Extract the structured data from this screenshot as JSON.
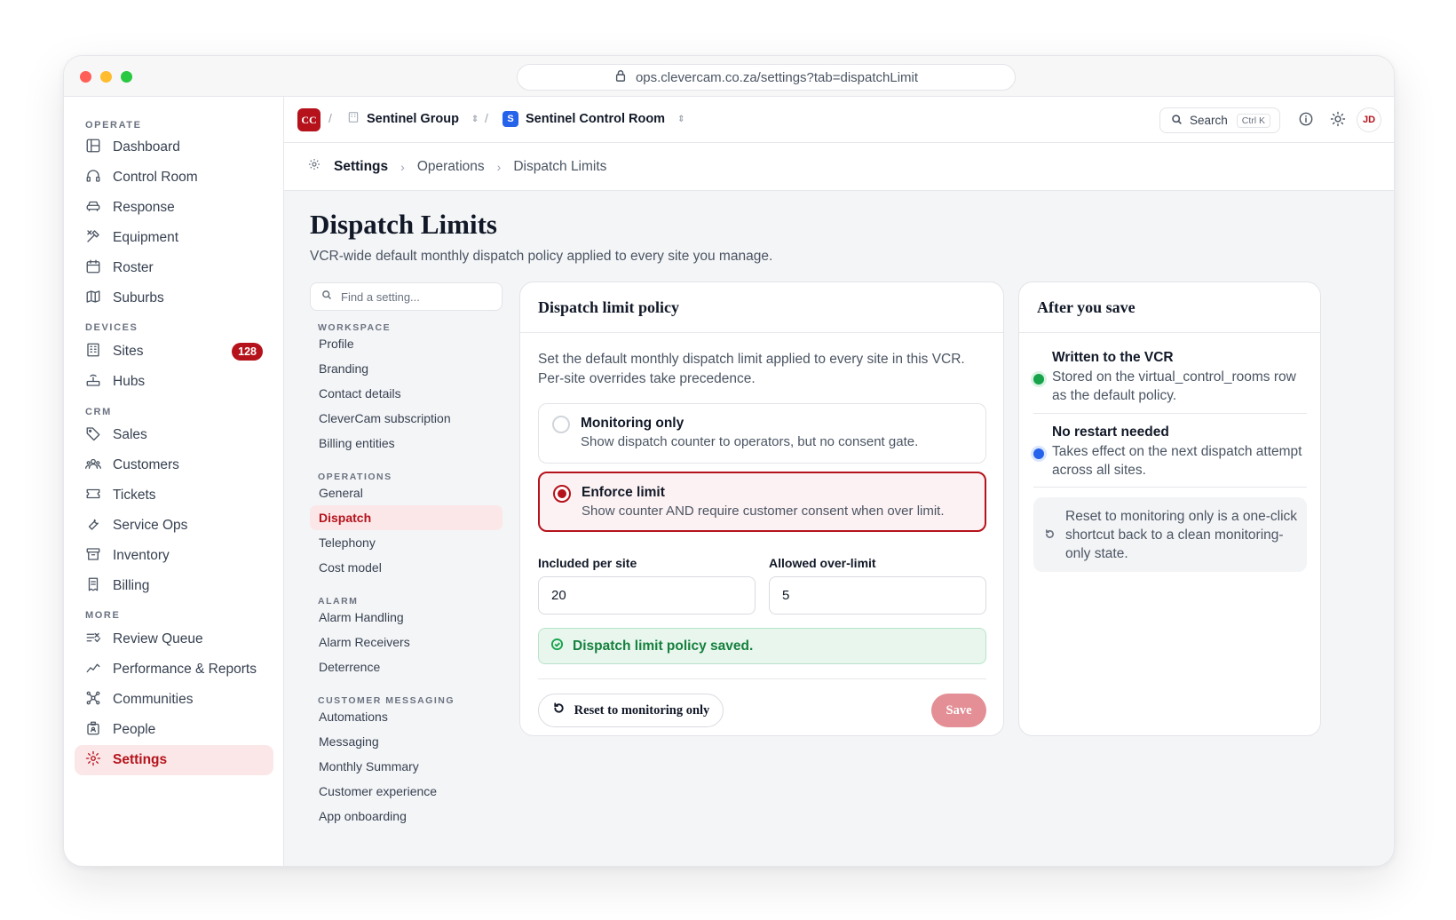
{
  "browser": {
    "url": "ops.clevercam.co.za/settings?tab=dispatchLimit"
  },
  "sidebar": {
    "sections": [
      {
        "label": "OPERATE"
      },
      {
        "label": "DEVICES"
      },
      {
        "label": "CRM"
      },
      {
        "label": "MORE"
      }
    ],
    "items": [
      {
        "label": "Dashboard",
        "icon": "dashboard-icon"
      },
      {
        "label": "Control Room",
        "icon": "headset-icon"
      },
      {
        "label": "Response",
        "icon": "car-icon"
      },
      {
        "label": "Equipment",
        "icon": "tools-icon"
      },
      {
        "label": "Roster",
        "icon": "calendar-icon"
      },
      {
        "label": "Suburbs",
        "icon": "map-icon"
      },
      {
        "label": "Sites",
        "icon": "building-icon",
        "badge": "128"
      },
      {
        "label": "Hubs",
        "icon": "router-icon"
      },
      {
        "label": "Sales",
        "icon": "tag-icon"
      },
      {
        "label": "Customers",
        "icon": "users-icon"
      },
      {
        "label": "Tickets",
        "icon": "ticket-icon"
      },
      {
        "label": "Service Ops",
        "icon": "wrench-icon"
      },
      {
        "label": "Inventory",
        "icon": "archive-icon"
      },
      {
        "label": "Billing",
        "icon": "receipt-icon"
      },
      {
        "label": "Review Queue",
        "icon": "list-check-icon"
      },
      {
        "label": "Performance & Reports",
        "icon": "trend-icon"
      },
      {
        "label": "Communities",
        "icon": "network-icon"
      },
      {
        "label": "People",
        "icon": "id-badge-icon"
      },
      {
        "label": "Settings",
        "icon": "gear-icon"
      }
    ]
  },
  "topbar": {
    "logo": "CC",
    "org": "Sentinel Group",
    "room_badge": "S",
    "room": "Sentinel Control Room",
    "search_label": "Search",
    "search_kbd": "Ctrl K",
    "avatar": "JD"
  },
  "breadcrumb": {
    "items": [
      "Settings",
      "Operations",
      "Dispatch Limits"
    ]
  },
  "page": {
    "title": "Dispatch Limits",
    "subtitle": "VCR-wide default monthly dispatch policy applied to every site you manage."
  },
  "settings_nav": {
    "search_placeholder": "Find a setting...",
    "sections": [
      "WORKSPACE",
      "OPERATIONS",
      "ALARM",
      "CUSTOMER MESSAGING"
    ],
    "items": [
      "Profile",
      "Branding",
      "Contact details",
      "CleverCam subscription",
      "Billing entities",
      "General",
      "Dispatch",
      "Telephony",
      "Cost model",
      "Alarm Handling",
      "Alarm Receivers",
      "Deterrence",
      "Automations",
      "Messaging",
      "Monthly Summary",
      "Customer experience",
      "App onboarding"
    ]
  },
  "policy": {
    "title": "Dispatch limit policy",
    "description": "Set the default monthly dispatch limit applied to every site in this VCR. Per-site overrides take precedence.",
    "options": [
      {
        "title": "Monitoring only",
        "desc": "Show dispatch counter to operators, but no consent gate.",
        "selected": false
      },
      {
        "title": "Enforce limit",
        "desc": "Show counter AND require customer consent when over limit.",
        "selected": true
      }
    ],
    "included_label": "Included per site",
    "included_value": "20",
    "overlimit_label": "Allowed over-limit",
    "overlimit_value": "5",
    "success": "Dispatch limit policy saved.",
    "reset_label": "Reset to monitoring only",
    "save_label": "Save",
    "accent": "#b5121b"
  },
  "after_save": {
    "title": "After you save",
    "items": [
      {
        "title": "Written to the VCR",
        "desc": "Stored on the virtual_control_rooms row as the default policy.",
        "color": "#16a34a"
      },
      {
        "title": "No restart needed",
        "desc": "Takes effect on the next dispatch attempt across all sites.",
        "color": "#2563eb"
      }
    ],
    "note": "Reset to monitoring only is a one-click shortcut back to a clean monitoring-only state."
  }
}
